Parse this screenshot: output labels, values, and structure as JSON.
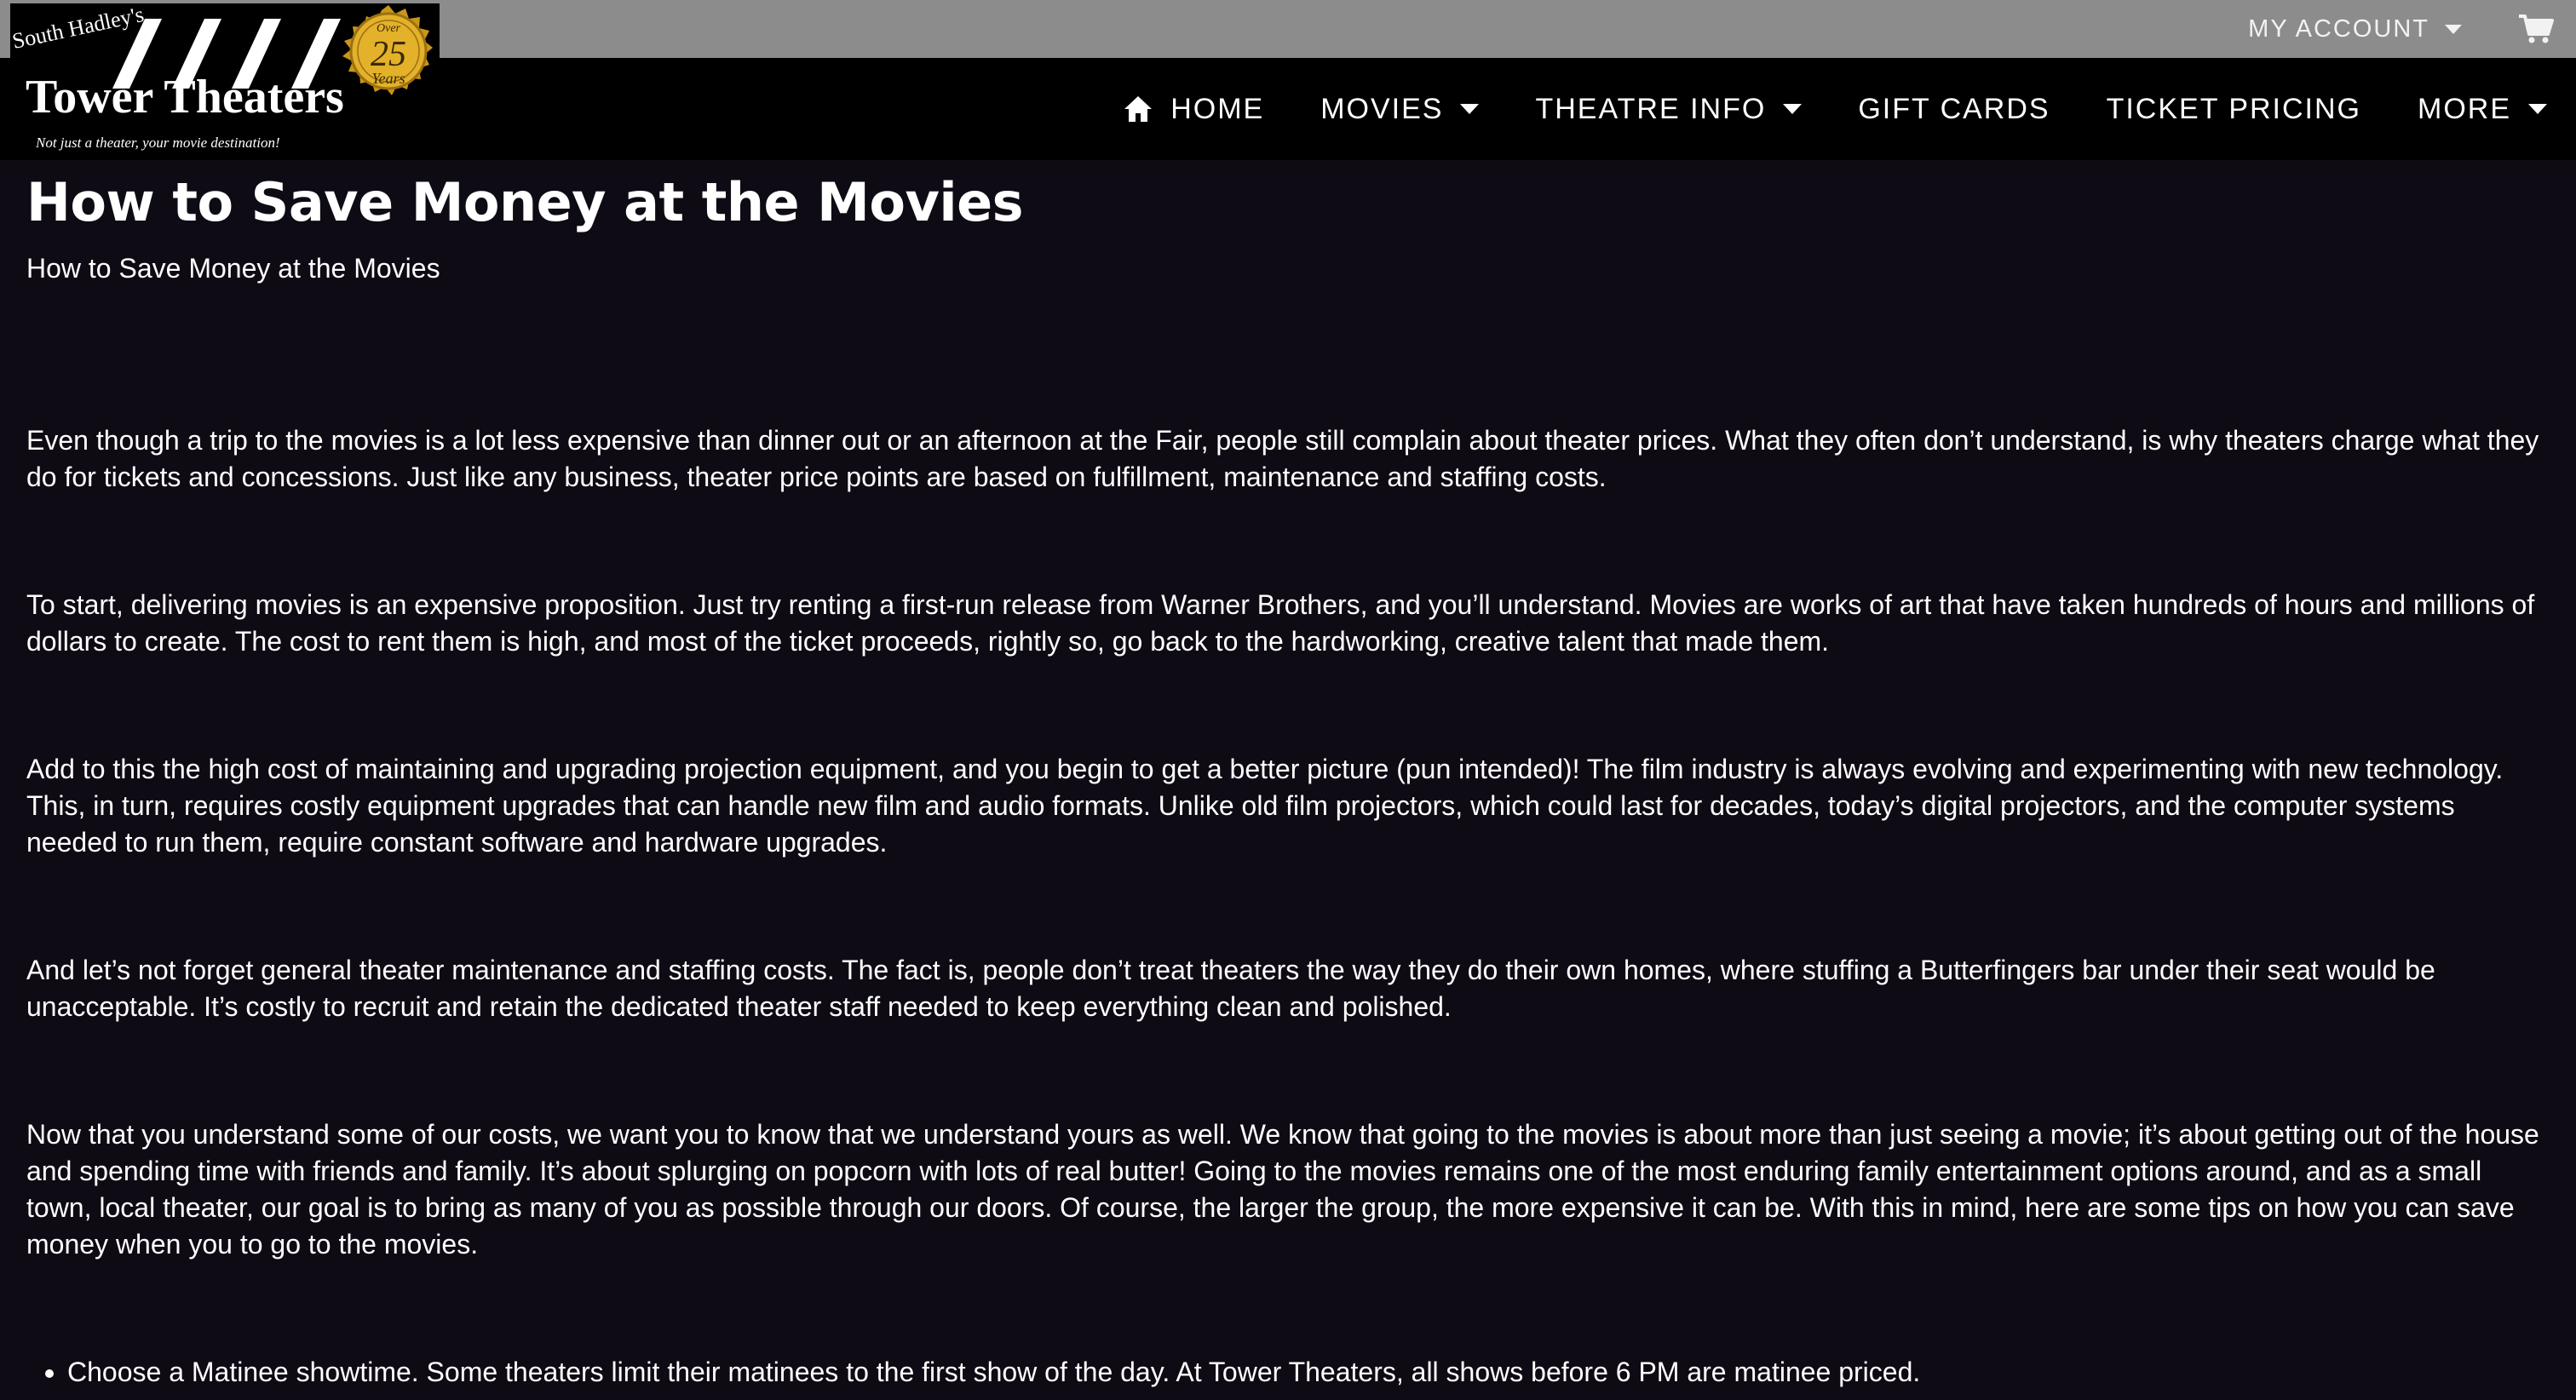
{
  "utility": {
    "account_label": "MY ACCOUNT",
    "cart_icon": "cart-icon"
  },
  "logo": {
    "top_text": "South Hadley's",
    "name": "Tower Theaters",
    "tagline": "Not just a theater, your movie destination!",
    "seal_over": "Over",
    "seal_number": "25",
    "seal_word": "Years"
  },
  "nav": {
    "items": [
      {
        "label": "HOME",
        "icon": "home-icon",
        "dropdown": false
      },
      {
        "label": "MOVIES",
        "dropdown": true
      },
      {
        "label": "THEATRE INFO",
        "dropdown": true
      },
      {
        "label": "GIFT CARDS",
        "dropdown": false
      },
      {
        "label": "TICKET PRICING",
        "dropdown": false
      },
      {
        "label": "MORE",
        "dropdown": true
      }
    ]
  },
  "article": {
    "title": "How to Save Money at the Movies",
    "subtitle": "How to Save Money at the Movies",
    "paragraphs": [
      "Even though a trip to the movies is a lot less expensive than dinner out or an afternoon at the Fair, people still complain about theater prices. What they often don’t understand, is why theaters charge what they do for tickets and concessions. Just like any business, theater price points are based on fulfillment, maintenance and staffing costs.",
      "To start, delivering movies is an expensive proposition. Just try renting a first-run release from Warner Brothers, and you’ll understand. Movies are works of art that have taken hundreds of hours and millions of dollars to create. The cost to rent them is high, and most of the ticket proceeds, rightly so, go back to the hardworking, creative talent that made them.",
      "Add to this the high cost of maintaining and upgrading projection equipment, and you begin to get a better picture (pun intended)! The film industry is always evolving and experimenting with new technology. This, in turn, requires costly equipment upgrades that can handle new film and audio formats. Unlike old film projectors, which could last for decades, today’s digital projectors, and the computer systems needed to run them, require constant software and hardware upgrades.",
      "And let’s not forget general theater maintenance and staffing costs. The fact is, people don’t treat theaters the way they do their own homes, where stuffing a Butterfingers bar under their seat would be unacceptable. It’s costly to recruit and retain the dedicated theater staff needed to keep everything clean and polished.",
      "Now that you understand some of our costs, we want you to know that we understand yours as well. We know that going to the movies is about more than just seeing a movie; it’s about getting out of the house and spending time with friends and family. It’s about splurging on popcorn with lots of real butter! Going to the movies remains one of the most enduring family entertainment options around, and as a small town, local theater, our goal is to bring as many of you as possible through our doors. Of course, the larger the group, the more expensive it can be. With this in mind, here are some tips on how you can save money when you to go to the movies."
    ],
    "tips": [
      "Choose a Matinee showtime. Some theaters limit their matinees to the first show of the day. At Tower Theaters, all shows before 6 PM are matinee priced."
    ]
  },
  "colors": {
    "topbar": "#8c8c8c",
    "navbar": "#000000",
    "page_background": "#0e0b14",
    "text": "#ffffff",
    "seal_gold": "#d4a017"
  }
}
